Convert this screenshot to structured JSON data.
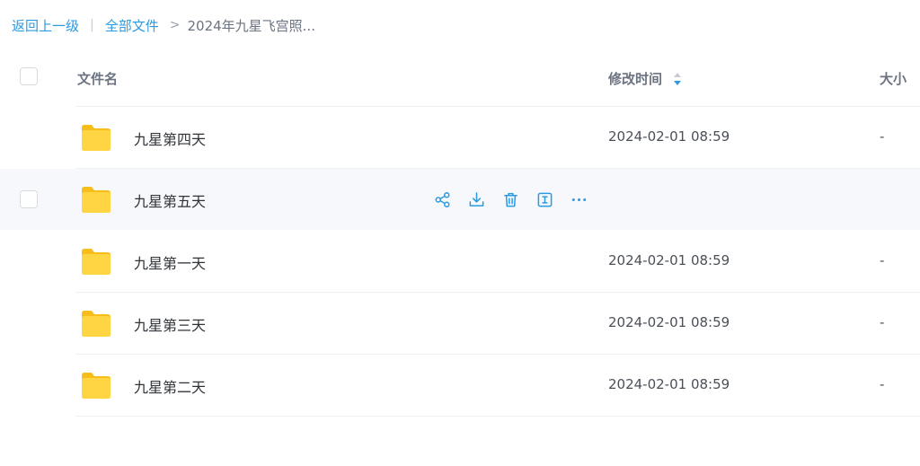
{
  "breadcrumb": {
    "back_label": "返回上一级",
    "separator": "|",
    "root_label": "全部文件",
    "arrow": ">",
    "current_label": "2024年九星飞宫照..."
  },
  "table": {
    "headers": {
      "name": "文件名",
      "modified": "修改时间",
      "size": "大小"
    },
    "rows": [
      {
        "name": "九星第四天",
        "modified": "2024-02-01 08:59",
        "size": "-",
        "icon": "folder-icon",
        "hovered": false
      },
      {
        "name": "九星第五天",
        "modified": "",
        "size": "",
        "icon": "folder-icon",
        "hovered": true
      },
      {
        "name": "九星第一天",
        "modified": "2024-02-01 08:59",
        "size": "-",
        "icon": "folder-icon",
        "hovered": false
      },
      {
        "name": "九星第三天",
        "modified": "2024-02-01 08:59",
        "size": "-",
        "icon": "folder-icon",
        "hovered": false
      },
      {
        "name": "九星第二天",
        "modified": "2024-02-01 08:59",
        "size": "-",
        "icon": "folder-icon",
        "hovered": false
      }
    ],
    "row_actions": [
      "share-icon",
      "download-icon",
      "delete-icon",
      "rename-icon",
      "more-icon"
    ]
  },
  "colors": {
    "accent": "#2c9ae0",
    "folder": "#ffd23f",
    "hover_row": "#f6f8fc",
    "text": "#2f3338",
    "muted": "#6b7280"
  }
}
